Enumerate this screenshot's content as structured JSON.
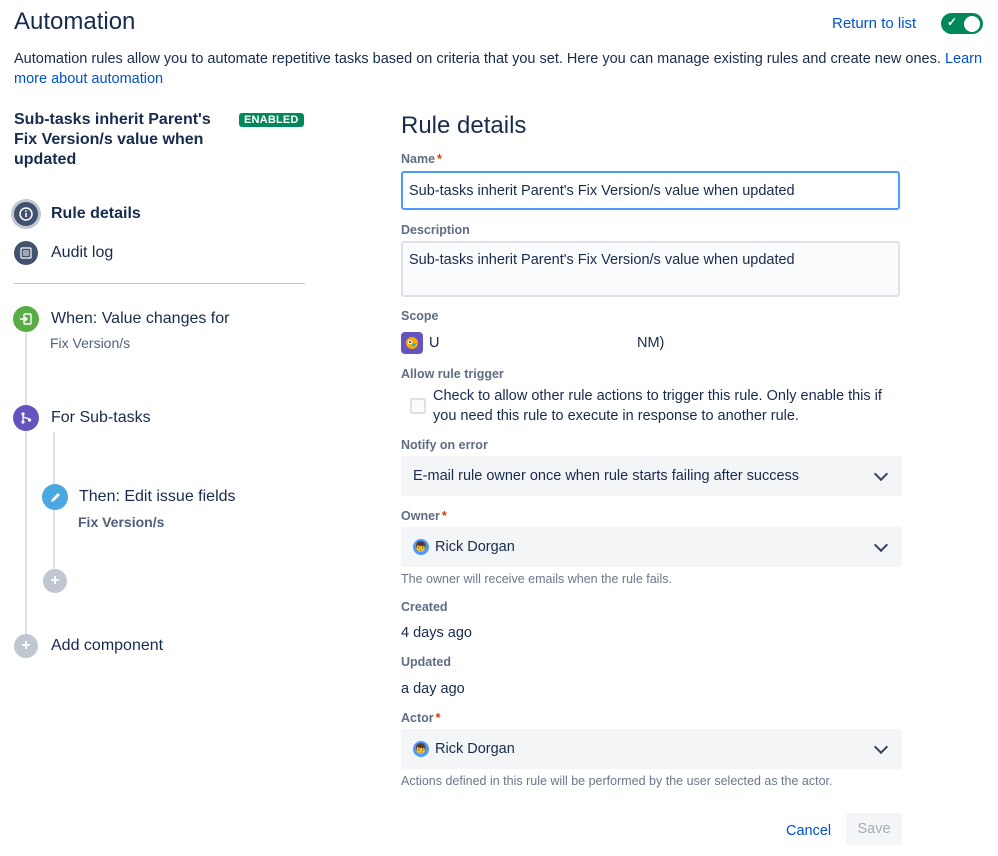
{
  "header": {
    "title": "Automation",
    "return_link": "Return to list",
    "rule_toggle_on": true,
    "intro_text": "Automation rules allow you to automate repetitive tasks based on criteria that you set. Here you can manage existing rules and create new ones. ",
    "learn_more": "Learn more about automation"
  },
  "sidebar": {
    "rule_name": "Sub-tasks inherit Parent's Fix Version/s value when updated",
    "status_badge": "ENABLED",
    "nav": [
      {
        "label": "Rule details",
        "icon": "info-icon",
        "active": true
      },
      {
        "label": "Audit log",
        "icon": "list-icon",
        "active": false
      }
    ],
    "components": {
      "trigger_title": "When: Value changes for",
      "trigger_sub": "Fix Version/s",
      "branch_title": "For Sub-tasks",
      "action_title": "Then: Edit issue fields",
      "action_sub": "Fix Version/s",
      "add_component": "Add component"
    },
    "colors": {
      "trigger": "#5aac44",
      "branch": "#6554c0",
      "action": "#4ba7e0"
    }
  },
  "form": {
    "section_title": "Rule details",
    "name_label": "Name",
    "name_value": "Sub-tasks inherit Parent's Fix Version/s value when updated",
    "description_label": "Description",
    "description_value": "Sub-tasks inherit Parent's Fix Version/s value when updated",
    "scope_label": "Scope",
    "scope_left": "U",
    "scope_right": "NM)",
    "allow_trigger_label": "Allow rule trigger",
    "allow_trigger_text": "Check to allow other rule actions to trigger this rule. Only enable this if you need this rule to execute in response to another rule.",
    "notify_label": "Notify on error",
    "notify_value": "E-mail rule owner once when rule starts failing after success",
    "owner_label": "Owner",
    "owner_value": "Rick Dorgan",
    "owner_helper": "The owner will receive emails when the rule fails.",
    "created_label": "Created",
    "created_value": "4 days ago",
    "updated_label": "Updated",
    "updated_value": "a day ago",
    "actor_label": "Actor",
    "actor_value": "Rick Dorgan",
    "actor_helper": "Actions defined in this rule will be performed by the user selected as the actor.",
    "cancel_label": "Cancel",
    "save_label": "Save"
  }
}
